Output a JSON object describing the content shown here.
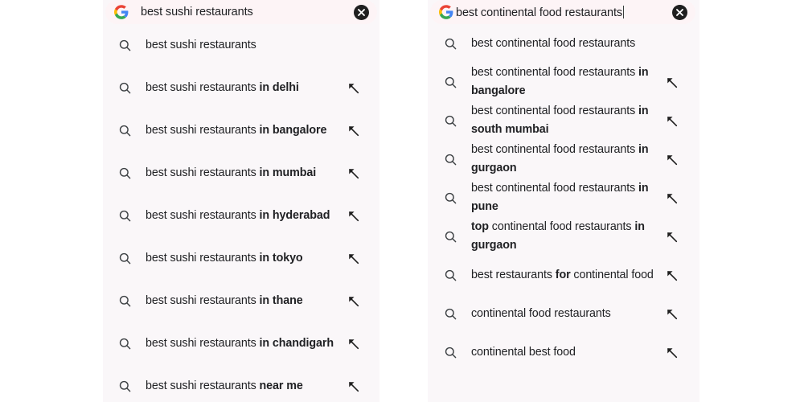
{
  "panels": [
    {
      "id": "left",
      "searchbar": {
        "logo": "google-g-icon",
        "query": "best sushi restaurants",
        "has_caret": false,
        "clear_icon": "close-circle-icon"
      },
      "suggestions": [
        {
          "plain": "best sushi restaurants",
          "bold": "",
          "tail": "",
          "lines": 1,
          "arrow": false
        },
        {
          "plain": "best sushi restaurants ",
          "bold": "in delhi",
          "tail": "",
          "lines": 1,
          "arrow": true
        },
        {
          "plain": "best sushi restaurants ",
          "bold": "in bangalore",
          "tail": "",
          "lines": 1,
          "arrow": true
        },
        {
          "plain": "best sushi restaurants ",
          "bold": "in mumbai",
          "tail": "",
          "lines": 1,
          "arrow": true
        },
        {
          "plain": "best sushi restaurants ",
          "bold": "in hyderabad",
          "tail": "",
          "lines": 2,
          "arrow": true
        },
        {
          "plain": "best sushi restaurants ",
          "bold": "in tokyo",
          "tail": "",
          "lines": 1,
          "arrow": true
        },
        {
          "plain": "best sushi restaurants ",
          "bold": "in thane",
          "tail": "",
          "lines": 1,
          "arrow": true
        },
        {
          "plain": "best sushi restaurants ",
          "bold": "in chandigarh",
          "tail": "",
          "lines": 2,
          "arrow": true
        },
        {
          "plain": "best sushi restaurants ",
          "bold": "near me",
          "tail": "",
          "lines": 1,
          "arrow": true
        }
      ]
    },
    {
      "id": "right",
      "searchbar": {
        "logo": "google-g-icon",
        "query": "best continental food restaurants",
        "has_caret": true,
        "clear_icon": "close-circle-icon"
      },
      "suggestions": [
        {
          "plain": "best continental food restaurants",
          "bold": "",
          "tail": "",
          "lines": 1,
          "arrow": false
        },
        {
          "plain": "best continental food restaurants ",
          "bold": "in bangalore",
          "tail": "",
          "lines": 2,
          "arrow": true
        },
        {
          "plain": "best continental food restaurants ",
          "bold": "in south mumbai",
          "tail": "",
          "lines": 2,
          "arrow": true
        },
        {
          "plain": "best continental food restaurants ",
          "bold": "in gurgaon",
          "tail": "",
          "lines": 2,
          "arrow": true
        },
        {
          "plain": "best continental food restaurants ",
          "bold": "in pune",
          "tail": "",
          "lines": 2,
          "arrow": true
        },
        {
          "plain": "",
          "bold": "top",
          "tail": " continental food restaurants ",
          "bold2": "in gurgaon",
          "lines": 2,
          "arrow": true
        },
        {
          "plain": "best restaurants ",
          "bold": "for",
          "tail": " continental food",
          "lines": 2,
          "arrow": true
        },
        {
          "plain": "continental food restaurants",
          "bold": "",
          "tail": "",
          "lines": 1,
          "arrow": true
        },
        {
          "plain": "continental best food",
          "bold": "",
          "tail": "",
          "lines": 1,
          "arrow": true
        }
      ]
    }
  ],
  "colors": {
    "panel_bg": "#faf7f9",
    "searchbar_bg": "#fdf4f6",
    "text": "#202124",
    "clear_button_bg": "#1f1f1f",
    "google_blue": "#4285F4",
    "google_green": "#34A853",
    "google_yellow": "#FBBC05",
    "google_red": "#EA4335"
  }
}
